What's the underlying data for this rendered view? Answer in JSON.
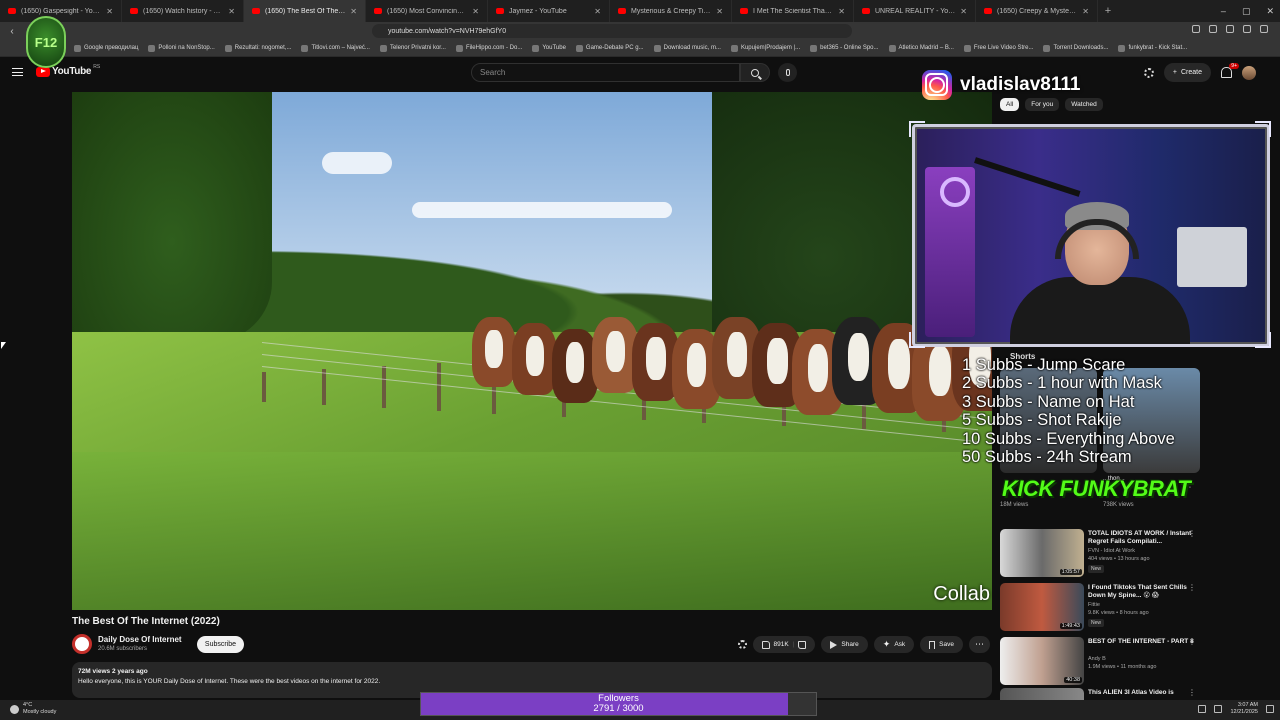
{
  "browser": {
    "tabs": [
      {
        "label": "(1650) Gaspesight - YouTube",
        "active": false
      },
      {
        "label": "(1650) Watch history - YouTube",
        "active": false
      },
      {
        "label": "(1650) The Best Of The Interne",
        "active": true
      },
      {
        "label": "(1650) Most Convincing Evidence Of",
        "active": false
      },
      {
        "label": "Jaymez - YouTube",
        "active": false
      },
      {
        "label": "Mysterious & Creepy TikToks That'll",
        "active": false
      },
      {
        "label": "I Met The Scientist That Scanned Re",
        "active": false
      },
      {
        "label": "UNREAL REALITY - YouTube",
        "active": false
      },
      {
        "label": "(1650) Creepy & Mysterious Videos",
        "active": false
      }
    ],
    "url": "youtube.com/watch?v=NVH79ehGfY0",
    "bookmarks": [
      "Google преводилац",
      "Polloni na NonStop...",
      "Rezultati: nogomet,...",
      "Titlovi.com – Najveć...",
      "Telenor Privatni kor...",
      "FileHippo.com - Do...",
      "YouTube",
      "Game-Debate PC g...",
      "Download music, m...",
      "Kupujem|Prodajem |...",
      "bet365 - Online Spo...",
      "Atletico Madrid – B...",
      "Free Live Video Stre...",
      "Torrent Downloads...",
      "funkybrat - Kick Stat..."
    ]
  },
  "overlay_logo_text": "F12",
  "youtube": {
    "logo": "YouTube",
    "region": "RS",
    "search_placeholder": "Search",
    "create_label": "Create",
    "notif_count": "9+",
    "video": {
      "title": "The Best Of The Internet (2022)",
      "channel": "Daily Dose Of Internet",
      "subscribers": "20.6M subscribers",
      "subscribe_label": "Subscribe",
      "likes": "891K",
      "share_label": "Share",
      "ask_label": "Ask",
      "save_label": "Save",
      "views_age": "72M views  2 years ago",
      "description": "Hello everyone, this is YOUR Daily Dose of Internet. These were the best videos on the internet for 2022.",
      "overlay_text": "Collab"
    },
    "chips": [
      "All",
      "For you",
      "Watched"
    ],
    "shorts_label": "Shorts",
    "shorts": [
      {
        "title": "...",
        "views": "18M views"
      },
      {
        "title": "...thon...",
        "views": "738K views"
      }
    ],
    "recommendations": [
      {
        "title": "TOTAL IDIOTS AT WORK / Instant Regret Fails Compilati...",
        "channel": "FVN - Idiot At Work",
        "views": "404 views • 13 hours ago",
        "new": "New",
        "duration": "1:05:57"
      },
      {
        "title": "I Found Tiktoks That Sent Chills Down My Spine... 😮 😱",
        "channel": "Fittie",
        "views": "9.8K views • 8 hours ago",
        "new": "New",
        "duration": "1:49:43"
      },
      {
        "title": "BEST OF THE INTERNET - PART 8",
        "channel": "Andy B",
        "views": "1.9M views • 11 months ago",
        "new": "",
        "duration": "40:38"
      },
      {
        "title": "This ALIEN 3I Atlas Video is",
        "channel": "",
        "views": "",
        "new": "",
        "duration": ""
      }
    ]
  },
  "stream_overlay": {
    "instagram_handle": "vladislav8111",
    "goals": [
      "1 Subbs - Jump Scare",
      "2 Subbs - 1 hour with Mask",
      "3 Subbs - Name on Hat",
      "5 Subbs - Shot Rakije",
      "10 Subbs - Everything Above",
      "50 Subbs - 24h Stream"
    ],
    "kick_brand": "KICK FUNKYBRAT",
    "followers_label": "Followers",
    "followers_text": "2791 / 3000",
    "followers_progress": 0.9303
  },
  "taskbar": {
    "temp": "4°C",
    "weather": "Mostly cloudy",
    "time": "3:07 AM",
    "date": "12/21/2025"
  }
}
